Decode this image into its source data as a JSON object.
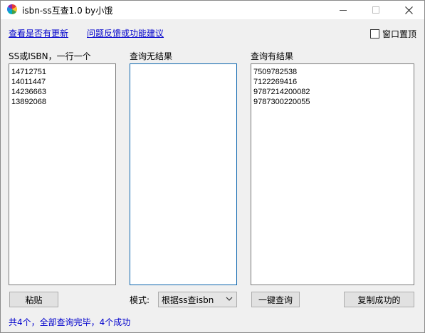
{
  "window": {
    "title": "isbn-ss互查1.0 by小饿"
  },
  "links": {
    "update": "查看是否有更新",
    "feedback": "问题反馈或功能建议"
  },
  "ontop": {
    "label": "窗口置顶",
    "checked": false
  },
  "columns": {
    "input_label": "SS或ISBN，一行一个",
    "no_result_label": "查询无结果",
    "result_label": "查询有结果"
  },
  "input_lines": [
    "14712751",
    "14011447",
    "14236663",
    "13892068"
  ],
  "no_result_lines": [],
  "result_lines": [
    "7509782538",
    "7122269416",
    "9787214200082",
    "9787300220055"
  ],
  "buttons": {
    "paste": "粘贴",
    "query": "一键查询",
    "copy": "复制成功的"
  },
  "mode": {
    "label": "模式:",
    "value": "根据ss查isbn"
  },
  "status": "共4个，全部查询完毕，4个成功",
  "icons": {
    "app": "color-wheel-icon",
    "minimize": "minimize-icon",
    "maximize": "maximize-icon",
    "close": "close-icon",
    "dropdown": "chevron-down-icon"
  }
}
